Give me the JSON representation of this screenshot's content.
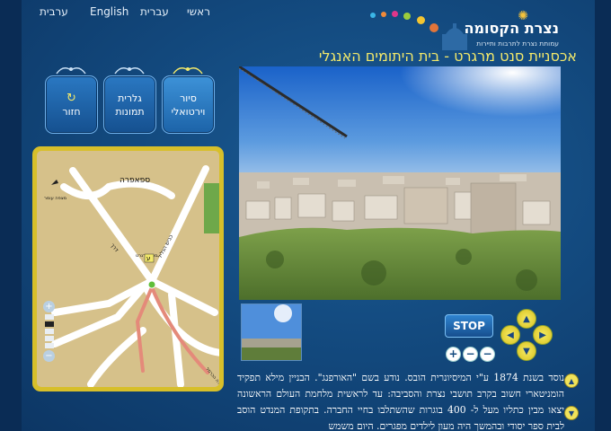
{
  "nav": {
    "main": "ראשי",
    "hebrew": "עברית",
    "english": "English",
    "arabic": "ערבית"
  },
  "logo": {
    "title": "נצרת הקסומה",
    "subtitle": "עמותת נצרת לתרבות ותיירות"
  },
  "page_title": "אכסניית סנט מרגרט - בית היתומים האנגלי",
  "buttons": {
    "virtual_tour_line1": "סיור",
    "virtual_tour_line2": "וירטואלי",
    "gallery_line1": "גלרית",
    "gallery_line2": "תמונות",
    "back_symbol": "↻",
    "back": "חזור"
  },
  "map": {
    "label_safafra": "ספאפרה",
    "label_st_margaret": "סנט מרגרט",
    "label_main_road": "כביש הגליל",
    "label_mount": "מעלה הכרמל",
    "label_route": "דרך",
    "label_marker": "ע",
    "label_lookout": "מצפה עומר"
  },
  "controls": {
    "stop": "STOP",
    "plus": "+",
    "minus": "−",
    "minus2": "−",
    "up": "▲",
    "down": "▼",
    "left": "◀",
    "right": "▶",
    "scroll_up": "▲",
    "scroll_down": "▼"
  },
  "description": "נוסד בשנת 1874 ע\"י המיסיונרית הובס. נודע בשם \"האורפנג\". הבניין מילא תפקיד הומניטארי חשוב בקרב תושבי נצרת והסביבה: עד לראשית מלחמת העולם הראשונה יצאו מבין כתליו מעל ל- 400 בוגרות שהשתלבו בחיי החברה. בתקופת המנדט הוסב לבית ספר יסודי ובהמשך היה מעון לילדים מפגרים. היום משמש",
  "colors": {
    "background": "#134a7f",
    "title": "#f3e96a",
    "map_frame": "#d7bf2a",
    "route": "#e48a7a"
  }
}
